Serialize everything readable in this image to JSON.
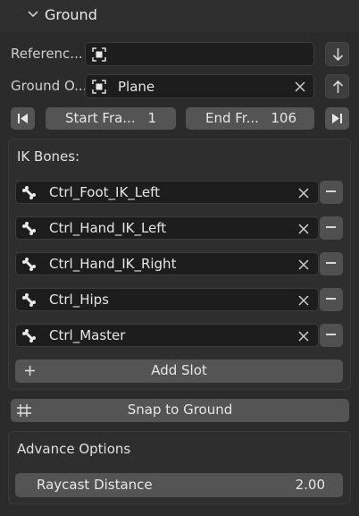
{
  "header": {
    "title": "Ground"
  },
  "reference": {
    "label": "Referenc...",
    "value": ""
  },
  "ground_object": {
    "label": "Ground O...",
    "value": "Plane"
  },
  "frames": {
    "start_label": "Start Fra...",
    "start_value": "1",
    "end_label": "End Fr...",
    "end_value": "106"
  },
  "ik_bones": {
    "title": "IK Bones:",
    "items": [
      "Ctrl_Foot_IK_Left",
      "Ctrl_Hand_IK_Left",
      "Ctrl_Hand_IK_Right",
      "Ctrl_Hips",
      "Ctrl_Master"
    ],
    "add_slot_label": "Add Slot"
  },
  "snap_button": {
    "label": "Snap to Ground"
  },
  "advance": {
    "title": "Advance Options",
    "raycast_label": "Raycast Distance",
    "raycast_value": "2.00"
  }
}
